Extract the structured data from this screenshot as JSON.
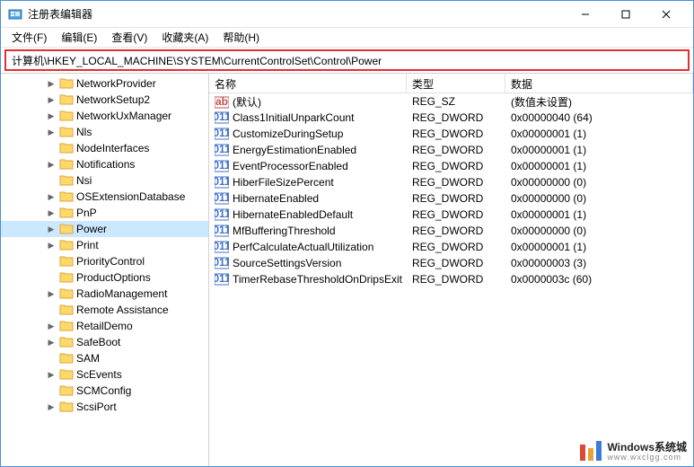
{
  "window": {
    "title": "注册表编辑器"
  },
  "menu": {
    "file": "文件(F)",
    "edit": "编辑(E)",
    "view": "查看(V)",
    "favorites": "收藏夹(A)",
    "help": "帮助(H)"
  },
  "address": "计算机\\HKEY_LOCAL_MACHINE\\SYSTEM\\CurrentControlSet\\Control\\Power",
  "tree": [
    {
      "label": "NetworkProvider",
      "expandable": true
    },
    {
      "label": "NetworkSetup2",
      "expandable": true
    },
    {
      "label": "NetworkUxManager",
      "expandable": true
    },
    {
      "label": "Nls",
      "expandable": true
    },
    {
      "label": "NodeInterfaces",
      "expandable": false
    },
    {
      "label": "Notifications",
      "expandable": true
    },
    {
      "label": "Nsi",
      "expandable": false
    },
    {
      "label": "OSExtensionDatabase",
      "expandable": true
    },
    {
      "label": "PnP",
      "expandable": true
    },
    {
      "label": "Power",
      "expandable": true,
      "selected": true
    },
    {
      "label": "Print",
      "expandable": true
    },
    {
      "label": "PriorityControl",
      "expandable": false
    },
    {
      "label": "ProductOptions",
      "expandable": false
    },
    {
      "label": "RadioManagement",
      "expandable": true
    },
    {
      "label": "Remote Assistance",
      "expandable": false
    },
    {
      "label": "RetailDemo",
      "expandable": true
    },
    {
      "label": "SafeBoot",
      "expandable": true
    },
    {
      "label": "SAM",
      "expandable": false
    },
    {
      "label": "ScEvents",
      "expandable": true
    },
    {
      "label": "SCMConfig",
      "expandable": false
    },
    {
      "label": "ScsiPort",
      "expandable": true
    }
  ],
  "columns": {
    "name": "名称",
    "type": "类型",
    "data": "数据"
  },
  "values": [
    {
      "icon": "str",
      "name": "(默认)",
      "type": "REG_SZ",
      "data": "(数值未设置)"
    },
    {
      "icon": "bin",
      "name": "Class1InitialUnparkCount",
      "type": "REG_DWORD",
      "data": "0x00000040 (64)"
    },
    {
      "icon": "bin",
      "name": "CustomizeDuringSetup",
      "type": "REG_DWORD",
      "data": "0x00000001 (1)"
    },
    {
      "icon": "bin",
      "name": "EnergyEstimationEnabled",
      "type": "REG_DWORD",
      "data": "0x00000001 (1)"
    },
    {
      "icon": "bin",
      "name": "EventProcessorEnabled",
      "type": "REG_DWORD",
      "data": "0x00000001 (1)"
    },
    {
      "icon": "bin",
      "name": "HiberFileSizePercent",
      "type": "REG_DWORD",
      "data": "0x00000000 (0)"
    },
    {
      "icon": "bin",
      "name": "HibernateEnabled",
      "type": "REG_DWORD",
      "data": "0x00000000 (0)"
    },
    {
      "icon": "bin",
      "name": "HibernateEnabledDefault",
      "type": "REG_DWORD",
      "data": "0x00000001 (1)"
    },
    {
      "icon": "bin",
      "name": "MfBufferingThreshold",
      "type": "REG_DWORD",
      "data": "0x00000000 (0)"
    },
    {
      "icon": "bin",
      "name": "PerfCalculateActualUtilization",
      "type": "REG_DWORD",
      "data": "0x00000001 (1)"
    },
    {
      "icon": "bin",
      "name": "SourceSettingsVersion",
      "type": "REG_DWORD",
      "data": "0x00000003 (3)"
    },
    {
      "icon": "bin",
      "name": "TimerRebaseThresholdOnDripsExit",
      "type": "REG_DWORD",
      "data": "0x0000003c (60)"
    }
  ],
  "watermark": {
    "text": "Windows系统城",
    "url": "www.wxclgg.com"
  }
}
